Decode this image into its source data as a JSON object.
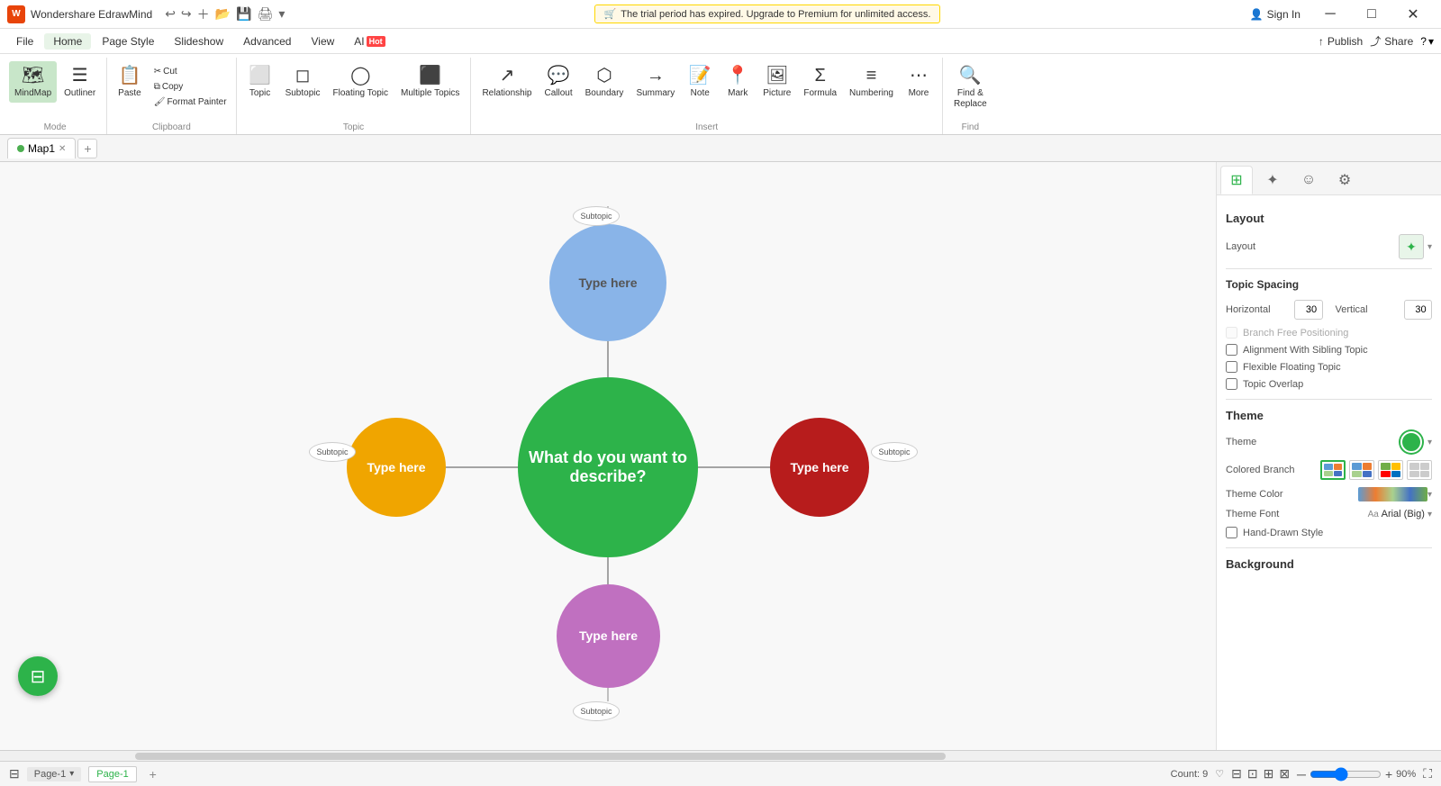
{
  "app": {
    "title": "Wondershare EdrawMind",
    "logo": "W"
  },
  "trial_banner": {
    "text": "The trial period has expired. Upgrade to Premium for unlimited access.",
    "cart_icon": "🛒"
  },
  "title_bar": {
    "minimize": "─",
    "restore": "□",
    "close": "✕"
  },
  "menu": {
    "items": [
      "File",
      "Home",
      "Page Style",
      "Slideshow",
      "Advanced",
      "View"
    ],
    "ai_label": "AI",
    "hot_label": "Hot",
    "publish_label": "Publish",
    "share_label": "Share",
    "help_icon": "?"
  },
  "ribbon": {
    "mode_group": {
      "label": "Mode",
      "mindmap": {
        "icon": "🗺",
        "label": "MindMap"
      },
      "outliner": {
        "icon": "☰",
        "label": "Outliner"
      }
    },
    "clipboard_group": {
      "label": "Clipboard",
      "paste": {
        "icon": "📋",
        "label": "Paste"
      },
      "cut": {
        "icon": "✂",
        "label": "Cut"
      },
      "copy": {
        "icon": "⧉",
        "label": "Copy"
      },
      "format_painter": {
        "icon": "🖌",
        "label": "Format Painter"
      }
    },
    "topic_group": {
      "label": "Topic",
      "topic": {
        "icon": "⬜",
        "label": "Topic"
      },
      "subtopic": {
        "icon": "◻",
        "label": "Subtopic"
      },
      "floating_topic": {
        "icon": "◯",
        "label": "Floating Topic"
      },
      "multiple_topics": {
        "icon": "⬛",
        "label": "Multiple Topics"
      }
    },
    "insert_group": {
      "label": "Insert",
      "relationship": {
        "icon": "↗",
        "label": "Relationship"
      },
      "callout": {
        "icon": "💬",
        "label": "Callout"
      },
      "boundary": {
        "icon": "⬡",
        "label": "Boundary"
      },
      "summary": {
        "icon": "→",
        "label": "Summary"
      },
      "note": {
        "icon": "📝",
        "label": "Note"
      },
      "mark": {
        "icon": "📍",
        "label": "Mark"
      },
      "picture": {
        "icon": "🖼",
        "label": "Picture"
      },
      "formula": {
        "icon": "Σ",
        "label": "Formula"
      },
      "numbering": {
        "icon": "≡",
        "label": "Numbering"
      },
      "more": {
        "icon": "⋯",
        "label": "More"
      }
    },
    "find_group": {
      "label": "Find",
      "find_replace": {
        "icon": "🔍",
        "label": "Find & Replace"
      }
    }
  },
  "tab_bar": {
    "map_name": "Map1",
    "dot_color": "green",
    "add_icon": "+"
  },
  "canvas": {
    "nodes": {
      "center": {
        "text": "What do you want to describe?",
        "color": "#2db34a",
        "text_color": "white"
      },
      "top": {
        "text": "Type here",
        "color": "#89b4e8",
        "text_color": "#555"
      },
      "left": {
        "text": "Type here",
        "color": "#f0a500",
        "text_color": "white"
      },
      "right": {
        "text": "Type here",
        "color": "#b71c1c",
        "text_color": "white"
      },
      "bottom": {
        "text": "Type here",
        "color": "#c070c0",
        "text_color": "white"
      }
    },
    "subtopics": {
      "top": "Subtopic",
      "left": "Subtopic",
      "right": "Subtopic",
      "bottom": "Subtopic"
    }
  },
  "right_panel": {
    "tabs": [
      {
        "icon": "⊞",
        "active": true
      },
      {
        "icon": "✦",
        "active": false
      },
      {
        "icon": "☺",
        "active": false
      },
      {
        "icon": "⚙",
        "active": false
      }
    ],
    "section_layout": "Layout",
    "layout_label": "Layout",
    "topic_spacing_label": "Topic Spacing",
    "horizontal_label": "Horizontal",
    "horizontal_value": "30",
    "vertical_label": "Vertical",
    "vertical_value": "30",
    "branch_free": "Branch Free Positioning",
    "alignment": "Alignment With Sibling Topic",
    "flexible": "Flexible Floating Topic",
    "topic_overlap": "Topic Overlap",
    "section_theme": "Theme",
    "theme_label": "Theme",
    "colored_branch_label": "Colored Branch",
    "theme_color_label": "Theme Color",
    "theme_font_label": "Theme Font",
    "theme_font_value": "Arial (Big)",
    "hand_drawn_label": "Hand-Drawn Style",
    "section_background": "Background"
  },
  "status_bar": {
    "sidebar_icon": "⊟",
    "page_label": "Page-1",
    "tab_label": "Page-1",
    "add_icon": "+",
    "count_label": "Count: 9",
    "heart_icon": "♡",
    "zoom_minus": "─",
    "zoom_plus": "+",
    "zoom_value": "90%",
    "expand_icon": "⛶",
    "icons": [
      "⊟",
      "⊡",
      "⊞",
      "⊠"
    ]
  },
  "agent_btn": {
    "icon": "⊟"
  }
}
